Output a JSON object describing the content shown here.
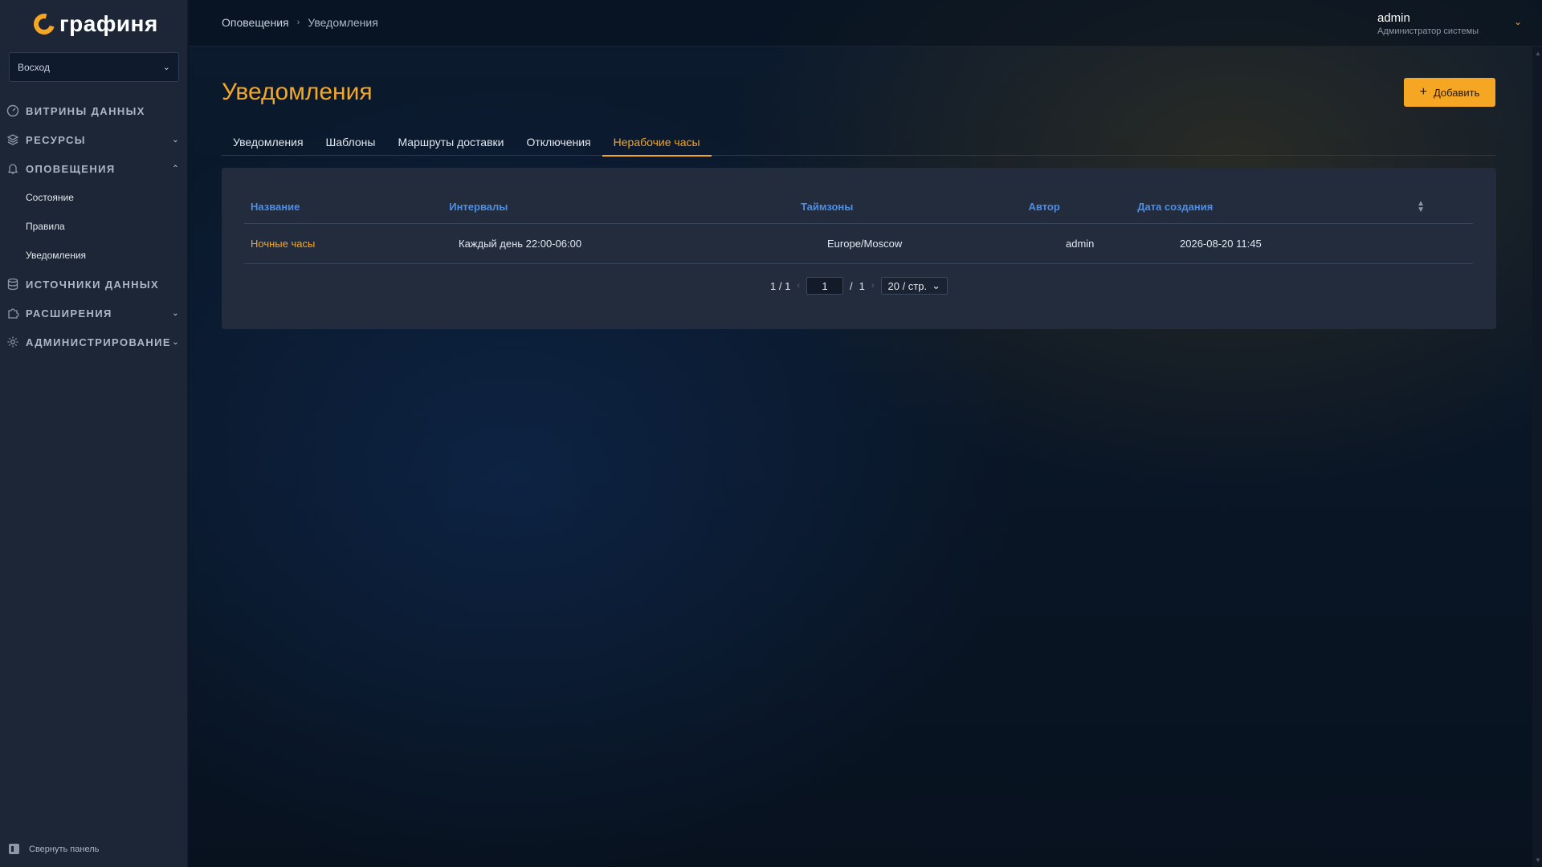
{
  "brand": {
    "name": "графиня",
    "accent": "#f5a623"
  },
  "sidebar": {
    "space_selector": {
      "value": "Восход"
    },
    "items": [
      {
        "label": "ВИТРИНЫ ДАННЫХ",
        "icon": "dashboard-icon",
        "expandable": false
      },
      {
        "label": "РЕСУРСЫ",
        "icon": "layers-icon",
        "expandable": true,
        "expanded": false
      },
      {
        "label": "ОПОВЕЩЕНИЯ",
        "icon": "bell-icon",
        "expandable": true,
        "expanded": true,
        "children": [
          {
            "label": "Состояние"
          },
          {
            "label": "Правила"
          },
          {
            "label": "Уведомления"
          }
        ]
      },
      {
        "label": "ИСТОЧНИКИ ДАННЫХ",
        "icon": "database-icon",
        "expandable": false
      },
      {
        "label": "РАСШИРЕНИЯ",
        "icon": "puzzle-icon",
        "expandable": true,
        "expanded": false
      },
      {
        "label": "АДМИНИСТРИРОВАНИЕ",
        "icon": "gear-icon",
        "expandable": true,
        "expanded": false
      }
    ],
    "collapse_label": "Свернуть панель"
  },
  "header": {
    "breadcrumb": [
      "Оповещения",
      "Уведомления"
    ],
    "user": {
      "name": "admin",
      "role": "Администратор системы"
    }
  },
  "page": {
    "title": "Уведомления",
    "add_button": "Добавить",
    "tabs": [
      {
        "label": "Уведомления",
        "active": false
      },
      {
        "label": "Шаблоны",
        "active": false
      },
      {
        "label": "Маршруты доставки",
        "active": false
      },
      {
        "label": "Отключения",
        "active": false
      },
      {
        "label": "Нерабочие часы",
        "active": true
      }
    ]
  },
  "table": {
    "columns": [
      "Название",
      "Интервалы",
      "Таймзоны",
      "Автор",
      "Дата создания"
    ],
    "rows": [
      {
        "name": "Ночные часы",
        "intervals": "Каждый день 22:00-06:00",
        "timezones": "Europe/Moscow",
        "author": "admin",
        "created": "2026-08-20 11:45"
      }
    ]
  },
  "pagination": {
    "summary": "1 / 1",
    "current_page": "1",
    "separator": "/",
    "total_pages": "1",
    "page_size": "20 / стр."
  }
}
